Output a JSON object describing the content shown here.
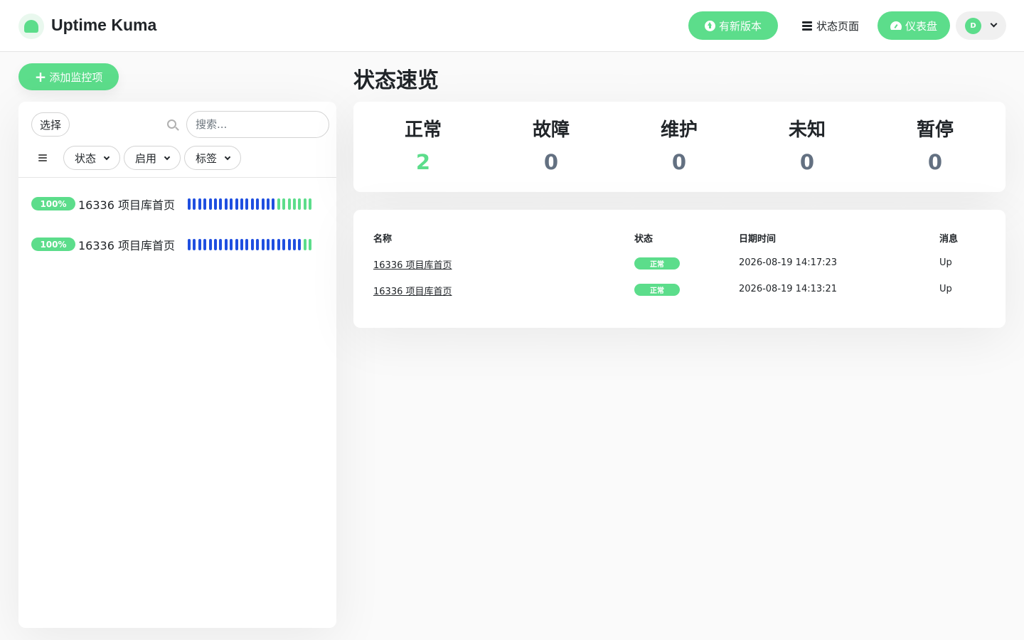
{
  "header": {
    "brand": "Uptime Kuma",
    "new_version_label": "有新版本",
    "status_page_label": "状态页面",
    "dashboard_label": "仪表盘",
    "avatar_initial": "D"
  },
  "sidebar": {
    "add_monitor_label": "添加监控项",
    "select_label": "选择",
    "search_placeholder": "搜索...",
    "filters": [
      "状态",
      "启用",
      "标签"
    ],
    "monitors": [
      {
        "uptime": "100%",
        "name": "16336 项目库首页",
        "heartbeats": [
          "up",
          "up",
          "up",
          "up",
          "up",
          "up",
          "up",
          "up",
          "up",
          "up",
          "up",
          "up",
          "up",
          "up",
          "up",
          "up",
          "up",
          "ok",
          "ok",
          "ok",
          "ok",
          "ok",
          "ok",
          "ok"
        ]
      },
      {
        "uptime": "100%",
        "name": "16336 项目库首页",
        "heartbeats": [
          "up",
          "up",
          "up",
          "up",
          "up",
          "up",
          "up",
          "up",
          "up",
          "up",
          "up",
          "up",
          "up",
          "up",
          "up",
          "up",
          "up",
          "up",
          "up",
          "up",
          "up",
          "up",
          "ok",
          "ok"
        ]
      }
    ]
  },
  "main": {
    "title": "状态速览",
    "stats": [
      {
        "label": "正常",
        "value": "2"
      },
      {
        "label": "故障",
        "value": "0"
      },
      {
        "label": "维护",
        "value": "0"
      },
      {
        "label": "未知",
        "value": "0"
      },
      {
        "label": "暂停",
        "value": "0"
      }
    ],
    "events": {
      "columns": [
        "名称",
        "状态",
        "日期时间",
        "消息"
      ],
      "rows": [
        {
          "name": "16336 项目库首页",
          "status": "正常",
          "datetime": "2026-08-19 14:17:23",
          "message": "Up"
        },
        {
          "name": "16336 项目库首页",
          "status": "正常",
          "datetime": "2026-08-19 14:13:21",
          "message": "Up"
        }
      ]
    }
  },
  "colors": {
    "accent": "#5cdd8b",
    "heartbeat_blue": "#1f4fe0",
    "heartbeat_green": "#5cdd8b",
    "stat_zero": "#637081"
  }
}
